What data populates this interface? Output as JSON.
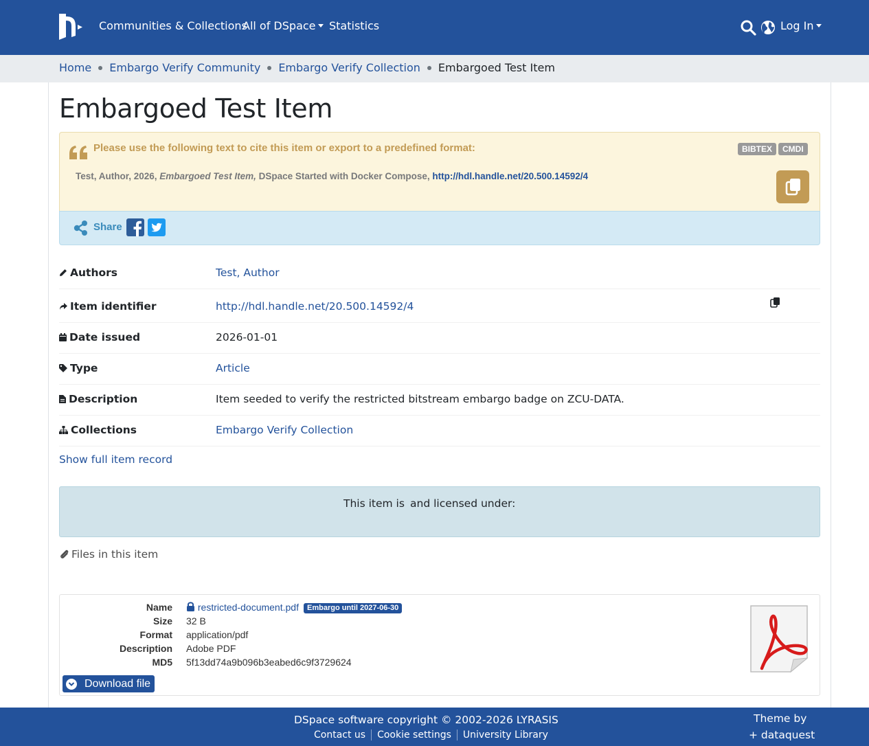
{
  "colors": {
    "brand": "#23529b",
    "cite_bg": "#fcf5dd",
    "cite_accent": "#c29b55",
    "share_bg": "#d4eaf5",
    "license_bg": "#d1e3ea"
  },
  "header": {
    "nav": [
      "Communities & Collections",
      "All of DSpace",
      "Statistics"
    ],
    "login": "Log In",
    "icons": [
      "dspace-logo-icon",
      "search-icon",
      "globe-icon"
    ]
  },
  "breadcrumb": [
    "Home",
    "Embargo Verify Community",
    "Embargo Verify Collection",
    "Embargoed Test Item"
  ],
  "title": "Embargoed Test Item",
  "citation": {
    "heading": "Please use the following text to cite this item or export to a predefined format:",
    "formats": [
      "BIBTEX",
      "CMDI"
    ],
    "text_prefix": "Test, Author, 2026, ",
    "text_title": "Embargoed Test Item,",
    "text_middle": " DSpace Started with Docker Compose, ",
    "text_link": "http://hdl.handle.net/20.500.14592/4"
  },
  "share": {
    "label": "Share",
    "icons": [
      "share-icon",
      "facebook-icon",
      "twitter-icon"
    ]
  },
  "metadata": [
    {
      "key": "Authors",
      "value": "Test, Author",
      "icon": "pencil-icon"
    },
    {
      "key": "Item identifier",
      "value": "http://hdl.handle.net/20.500.14592/4",
      "icon": "share-arrow-icon"
    },
    {
      "key": "Date issued",
      "value": "2026-01-01",
      "icon": "calendar-icon"
    },
    {
      "key": "Type",
      "value": "Article",
      "icon": "tag-icon"
    },
    {
      "key": "Description",
      "value": "Item seeded to verify the restricted bitstream embargo badge on ZCU-DATA.",
      "icon": "file-icon"
    },
    {
      "key": "Collections",
      "value": "Embargo Verify Collection",
      "icon": "sitemap-icon"
    }
  ],
  "show_full": "Show full item record",
  "license": {
    "part1": "This item is",
    "part2": "and licensed under:"
  },
  "files": {
    "heading": "Files in this item",
    "file": {
      "labels": {
        "name": "Name",
        "size": "Size",
        "format": "Format",
        "description": "Description",
        "md5": "MD5"
      },
      "name": "restricted-document.pdf",
      "embargo": "Embargo until 2027-06-30",
      "size": "32 B",
      "format": "application/pdf",
      "description": "Adobe PDF",
      "md5": "5f13dd74a9b096b3eabed6c9f3729624",
      "download": "Download file"
    }
  },
  "footer": {
    "copyright": "DSpace software copyright © 2002-2026 LYRASIS",
    "links": [
      "Contact us",
      "Cookie settings",
      "University Library"
    ],
    "theme_line1": "Theme by",
    "theme_line2": "+ dataquest"
  }
}
